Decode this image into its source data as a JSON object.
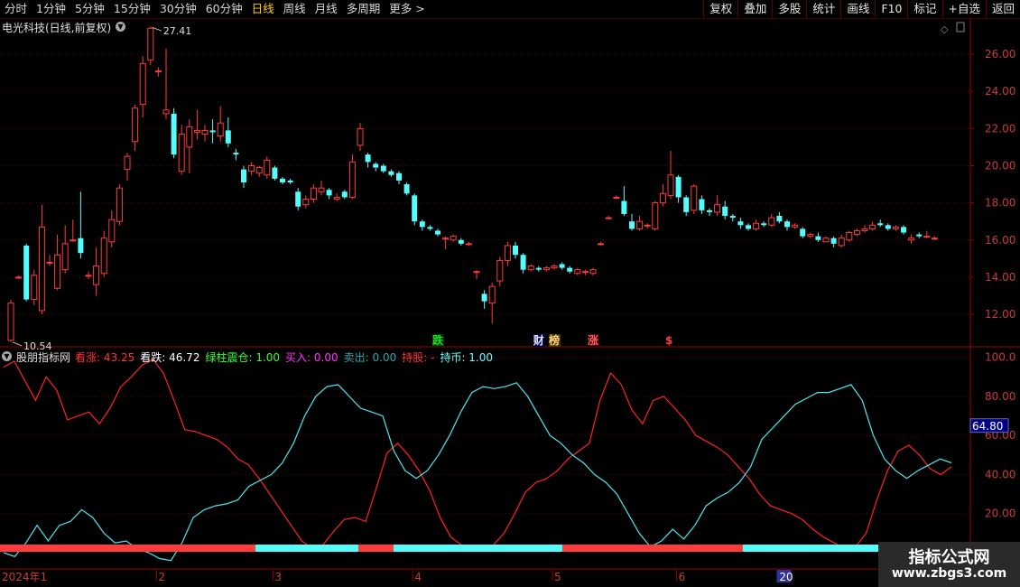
{
  "toolbar": {
    "periods": [
      {
        "label": "分时",
        "active": false
      },
      {
        "label": "1分钟",
        "active": false
      },
      {
        "label": "5分钟",
        "active": false
      },
      {
        "label": "15分钟",
        "active": false
      },
      {
        "label": "30分钟",
        "active": false
      },
      {
        "label": "60分钟",
        "active": false
      },
      {
        "label": "日线",
        "active": true
      },
      {
        "label": "周线",
        "active": false
      },
      {
        "label": "月线",
        "active": false
      },
      {
        "label": "多周期",
        "active": false
      },
      {
        "label": "更多",
        "active": false
      }
    ],
    "more_arrow": ">",
    "tools": [
      "复权",
      "叠加",
      "多股",
      "统计",
      "画线",
      "F10",
      "标记",
      "+自选",
      "返回"
    ]
  },
  "stock": {
    "title": "电光科技(日线,前复权)",
    "high_label": "27.41",
    "low_label": "10.54"
  },
  "price_axis": [
    "26.00",
    "24.00",
    "22.00",
    "20.00",
    "18.00",
    "16.00",
    "14.00",
    "12.00"
  ],
  "events": [
    {
      "label": "跌",
      "day": 55,
      "color": "#22dd22",
      "bg": "#003300"
    },
    {
      "label": "财",
      "day": 68,
      "color": "#e0e0ff",
      "bg": "#000044"
    },
    {
      "label": "榜",
      "day": 70,
      "color": "#ffd080",
      "bg": "#443300"
    },
    {
      "label": "涨",
      "day": 75,
      "color": "#ff6060",
      "bg": "#330000"
    },
    {
      "label": "$",
      "day": 85,
      "color": "#ff4040",
      "bg": ""
    }
  ],
  "indicator": {
    "name": "股朋指标网",
    "fields": [
      {
        "label": "看涨:",
        "value": "43.25",
        "color": "#ff3333"
      },
      {
        "label": "看跌:",
        "value": "46.72",
        "color": "#ffffff"
      },
      {
        "label": "绿柱震仓:",
        "value": "1.00",
        "color": "#33ff33"
      },
      {
        "label": "买入:",
        "value": "0.00",
        "color": "#ff33ff"
      },
      {
        "label": "卖出:",
        "value": "0.00",
        "color": "#22aaaa"
      },
      {
        "label": "持股:",
        "value": "-",
        "color": "#ff3333"
      },
      {
        "label": "持币:",
        "value": "1.00",
        "color": "#66ffff"
      }
    ],
    "axis": [
      "100.0",
      "80.00",
      "60.00",
      "40.00",
      "20.00"
    ],
    "current_label": "64.80"
  },
  "time_axis": [
    {
      "label": "2024年1",
      "day": 0
    },
    {
      "label": "2",
      "day": 19
    },
    {
      "label": "3",
      "day": 34
    },
    {
      "label": "4",
      "day": 52
    },
    {
      "label": "5",
      "day": 70
    },
    {
      "label": "6",
      "day": 86
    },
    {
      "label": "20",
      "day": 99
    }
  ],
  "watermark": {
    "title": "指标公式网",
    "url": "www.zbgs3.com"
  },
  "colors": {
    "up": "#ff3c3c",
    "down": "#54fcfc",
    "grid": "#7a0000",
    "axis_text": "#c83c3c",
    "kanzhang": "#ff2222",
    "kandie": "#4fe6f0"
  },
  "chart_data": [
    {
      "type": "candlestick",
      "x": "trading day index",
      "ylim": [
        10.3,
        27.9
      ],
      "candles": [
        {
          "o": 10.6,
          "c": 12.6,
          "h": 12.8,
          "l": 10.5
        },
        {
          "o": 14.0,
          "c": 14.0,
          "h": 14.1,
          "l": 13.9
        },
        {
          "o": 15.7,
          "c": 12.8,
          "h": 15.8,
          "l": 12.7
        },
        {
          "o": 12.8,
          "c": 14.1,
          "h": 14.4,
          "l": 12.5
        },
        {
          "o": 12.2,
          "c": 16.7,
          "h": 17.9,
          "l": 12.0
        },
        {
          "o": 14.8,
          "c": 14.8,
          "h": 15.2,
          "l": 14.6
        },
        {
          "o": 13.4,
          "c": 15.2,
          "h": 16.3,
          "l": 13.3
        },
        {
          "o": 14.4,
          "c": 15.8,
          "h": 16.8,
          "l": 14.2
        },
        {
          "o": 16.0,
          "c": 16.0,
          "h": 17.1,
          "l": 15.9
        },
        {
          "o": 16.1,
          "c": 15.3,
          "h": 18.6,
          "l": 15.0
        },
        {
          "o": 14.1,
          "c": 14.1,
          "h": 14.3,
          "l": 13.9
        },
        {
          "o": 13.6,
          "c": 14.6,
          "h": 15.6,
          "l": 13.0
        },
        {
          "o": 14.2,
          "c": 16.1,
          "h": 16.5,
          "l": 14.0
        },
        {
          "o": 15.9,
          "c": 17.1,
          "h": 17.6,
          "l": 15.6
        },
        {
          "o": 17.0,
          "c": 18.8,
          "h": 19.0,
          "l": 16.8
        },
        {
          "o": 19.8,
          "c": 20.5,
          "h": 20.7,
          "l": 19.2
        },
        {
          "o": 21.3,
          "c": 23.1,
          "h": 23.3,
          "l": 20.8
        },
        {
          "o": 23.3,
          "c": 25.5,
          "h": 25.9,
          "l": 22.6
        },
        {
          "o": 25.7,
          "c": 27.4,
          "h": 27.5,
          "l": 25.4
        },
        {
          "o": 25.1,
          "c": 25.1,
          "h": 25.3,
          "l": 24.8
        },
        {
          "o": 22.8,
          "c": 23.0,
          "h": 26.3,
          "l": 22.5
        },
        {
          "o": 22.8,
          "c": 20.6,
          "h": 23.1,
          "l": 20.4
        },
        {
          "o": 19.7,
          "c": 21.7,
          "h": 22.2,
          "l": 19.5
        },
        {
          "o": 21.0,
          "c": 22.1,
          "h": 22.5,
          "l": 19.6
        },
        {
          "o": 21.8,
          "c": 21.9,
          "h": 23.0,
          "l": 21.4
        },
        {
          "o": 21.7,
          "c": 21.9,
          "h": 22.2,
          "l": 21.3
        },
        {
          "o": 21.9,
          "c": 21.8,
          "h": 22.5,
          "l": 21.2
        },
        {
          "o": 21.6,
          "c": 22.3,
          "h": 23.2,
          "l": 21.3
        },
        {
          "o": 21.9,
          "c": 21.2,
          "h": 22.6,
          "l": 21.0
        },
        {
          "o": 20.7,
          "c": 20.6,
          "h": 20.9,
          "l": 20.3
        },
        {
          "o": 19.8,
          "c": 19.1,
          "h": 20.0,
          "l": 18.8
        },
        {
          "o": 19.7,
          "c": 20.0,
          "h": 20.2,
          "l": 19.5
        },
        {
          "o": 19.6,
          "c": 19.9,
          "h": 20.0,
          "l": 19.4
        },
        {
          "o": 19.5,
          "c": 20.3,
          "h": 20.5,
          "l": 19.3
        },
        {
          "o": 19.9,
          "c": 19.3,
          "h": 20.0,
          "l": 19.2
        },
        {
          "o": 19.3,
          "c": 19.1,
          "h": 19.4,
          "l": 19.0
        },
        {
          "o": 19.2,
          "c": 19.1,
          "h": 19.3,
          "l": 19.0
        },
        {
          "o": 18.6,
          "c": 17.8,
          "h": 18.8,
          "l": 17.6
        },
        {
          "o": 17.9,
          "c": 18.2,
          "h": 18.4,
          "l": 17.7
        },
        {
          "o": 18.2,
          "c": 18.8,
          "h": 19.0,
          "l": 18.0
        },
        {
          "o": 18.6,
          "c": 18.8,
          "h": 19.2,
          "l": 18.4
        },
        {
          "o": 18.7,
          "c": 18.4,
          "h": 18.8,
          "l": 18.2
        },
        {
          "o": 18.2,
          "c": 18.3,
          "h": 18.5,
          "l": 18.1
        },
        {
          "o": 18.6,
          "c": 18.3,
          "h": 18.7,
          "l": 18.2
        },
        {
          "o": 18.3,
          "c": 20.2,
          "h": 20.6,
          "l": 18.2
        },
        {
          "o": 21.1,
          "c": 22.0,
          "h": 22.3,
          "l": 20.8
        },
        {
          "o": 20.6,
          "c": 20.2,
          "h": 20.7,
          "l": 19.9
        },
        {
          "o": 20.1,
          "c": 19.9,
          "h": 20.2,
          "l": 19.7
        },
        {
          "o": 20.0,
          "c": 19.7,
          "h": 20.1,
          "l": 19.6
        },
        {
          "o": 19.7,
          "c": 19.5,
          "h": 19.8,
          "l": 19.4
        },
        {
          "o": 19.6,
          "c": 19.2,
          "h": 19.7,
          "l": 19.0
        },
        {
          "o": 19.0,
          "c": 18.5,
          "h": 19.1,
          "l": 18.4
        },
        {
          "o": 18.4,
          "c": 17.0,
          "h": 18.5,
          "l": 16.8
        },
        {
          "o": 17.0,
          "c": 16.7,
          "h": 17.1,
          "l": 16.5
        },
        {
          "o": 16.7,
          "c": 16.6,
          "h": 16.8,
          "l": 16.5
        },
        {
          "o": 16.5,
          "c": 16.3,
          "h": 16.6,
          "l": 16.2
        },
        {
          "o": 16.1,
          "c": 16.1,
          "h": 16.2,
          "l": 15.5
        },
        {
          "o": 16.0,
          "c": 16.2,
          "h": 16.3,
          "l": 15.9
        },
        {
          "o": 16.0,
          "c": 15.8,
          "h": 16.1,
          "l": 15.7
        },
        {
          "o": 15.8,
          "c": 15.8,
          "h": 15.9,
          "l": 15.7
        },
        {
          "o": 14.3,
          "c": 14.3,
          "h": 14.4,
          "l": 13.9
        },
        {
          "o": 13.1,
          "c": 12.7,
          "h": 13.3,
          "l": 12.3
        },
        {
          "o": 12.6,
          "c": 13.5,
          "h": 13.7,
          "l": 11.5
        },
        {
          "o": 13.8,
          "c": 14.9,
          "h": 15.1,
          "l": 13.5
        },
        {
          "o": 14.9,
          "c": 15.7,
          "h": 15.9,
          "l": 14.6
        },
        {
          "o": 15.7,
          "c": 15.2,
          "h": 15.9,
          "l": 15.0
        },
        {
          "o": 15.2,
          "c": 14.4,
          "h": 15.3,
          "l": 14.2
        },
        {
          "o": 14.4,
          "c": 14.6,
          "h": 14.7,
          "l": 14.3
        },
        {
          "o": 14.5,
          "c": 14.4,
          "h": 14.6,
          "l": 14.3
        },
        {
          "o": 14.4,
          "c": 14.5,
          "h": 14.6,
          "l": 14.3
        },
        {
          "o": 14.5,
          "c": 14.6,
          "h": 14.7,
          "l": 14.4
        },
        {
          "o": 14.7,
          "c": 14.5,
          "h": 14.8,
          "l": 14.4
        },
        {
          "o": 14.5,
          "c": 14.3,
          "h": 14.6,
          "l": 14.2
        },
        {
          "o": 14.2,
          "c": 14.4,
          "h": 14.5,
          "l": 14.1
        },
        {
          "o": 14.3,
          "c": 14.3,
          "h": 14.4,
          "l": 14.1
        },
        {
          "o": 14.2,
          "c": 14.4,
          "h": 14.5,
          "l": 14.1
        },
        {
          "o": 15.8,
          "c": 15.8,
          "h": 15.9,
          "l": 15.7
        },
        {
          "o": 17.2,
          "c": 17.2,
          "h": 17.3,
          "l": 17.1
        },
        {
          "o": 18.3,
          "c": 18.3,
          "h": 18.4,
          "l": 18.2
        },
        {
          "o": 18.1,
          "c": 17.4,
          "h": 18.9,
          "l": 17.3
        },
        {
          "o": 17.0,
          "c": 16.6,
          "h": 17.4,
          "l": 16.5
        },
        {
          "o": 16.6,
          "c": 17.0,
          "h": 17.3,
          "l": 16.5
        },
        {
          "o": 16.8,
          "c": 16.8,
          "h": 16.9,
          "l": 16.6
        },
        {
          "o": 16.6,
          "c": 18.0,
          "h": 18.1,
          "l": 16.5
        },
        {
          "o": 18.0,
          "c": 18.5,
          "h": 19.0,
          "l": 17.8
        },
        {
          "o": 18.4,
          "c": 19.5,
          "h": 20.8,
          "l": 18.2
        },
        {
          "o": 19.4,
          "c": 18.3,
          "h": 19.5,
          "l": 18.0
        },
        {
          "o": 18.3,
          "c": 17.5,
          "h": 18.4,
          "l": 17.3
        },
        {
          "o": 17.6,
          "c": 18.9,
          "h": 19.0,
          "l": 17.4
        },
        {
          "o": 18.2,
          "c": 17.6,
          "h": 18.4,
          "l": 17.4
        },
        {
          "o": 17.6,
          "c": 17.5,
          "h": 17.7,
          "l": 17.3
        },
        {
          "o": 17.5,
          "c": 17.9,
          "h": 18.4,
          "l": 17.3
        },
        {
          "o": 17.8,
          "c": 17.3,
          "h": 18.1,
          "l": 17.1
        },
        {
          "o": 17.3,
          "c": 17.2,
          "h": 17.4,
          "l": 17.0
        },
        {
          "o": 17.0,
          "c": 16.8,
          "h": 17.2,
          "l": 16.6
        },
        {
          "o": 16.8,
          "c": 16.6,
          "h": 16.9,
          "l": 16.5
        },
        {
          "o": 16.6,
          "c": 16.9,
          "h": 17.1,
          "l": 16.5
        },
        {
          "o": 16.9,
          "c": 16.8,
          "h": 17.0,
          "l": 16.7
        },
        {
          "o": 16.8,
          "c": 17.2,
          "h": 17.4,
          "l": 16.7
        },
        {
          "o": 17.3,
          "c": 17.0,
          "h": 17.5,
          "l": 16.9
        },
        {
          "o": 17.0,
          "c": 16.7,
          "h": 17.1,
          "l": 16.5
        },
        {
          "o": 16.7,
          "c": 16.8,
          "h": 16.9,
          "l": 16.6
        },
        {
          "o": 16.6,
          "c": 16.2,
          "h": 16.7,
          "l": 16.1
        },
        {
          "o": 16.2,
          "c": 16.3,
          "h": 16.4,
          "l": 16.1
        },
        {
          "o": 16.2,
          "c": 16.0,
          "h": 16.4,
          "l": 15.9
        },
        {
          "o": 15.9,
          "c": 16.1,
          "h": 16.2,
          "l": 15.9
        },
        {
          "o": 16.1,
          "c": 15.8,
          "h": 16.2,
          "l": 15.6
        },
        {
          "o": 15.7,
          "c": 16.1,
          "h": 16.3,
          "l": 15.6
        },
        {
          "o": 16.0,
          "c": 16.4,
          "h": 16.5,
          "l": 15.9
        },
        {
          "o": 16.3,
          "c": 16.5,
          "h": 16.6,
          "l": 16.2
        },
        {
          "o": 16.5,
          "c": 16.6,
          "h": 16.8,
          "l": 16.4
        },
        {
          "o": 16.6,
          "c": 16.8,
          "h": 17.0,
          "l": 16.5
        },
        {
          "o": 16.9,
          "c": 16.8,
          "h": 17.1,
          "l": 16.7
        },
        {
          "o": 16.8,
          "c": 16.6,
          "h": 16.9,
          "l": 16.5
        },
        {
          "o": 16.6,
          "c": 16.7,
          "h": 16.8,
          "l": 16.5
        },
        {
          "o": 16.7,
          "c": 16.4,
          "h": 16.8,
          "l": 16.3
        },
        {
          "o": 16.0,
          "c": 16.1,
          "h": 16.3,
          "l": 15.8
        },
        {
          "o": 16.3,
          "c": 16.2,
          "h": 16.4,
          "l": 16.1
        },
        {
          "o": 16.2,
          "c": 16.2,
          "h": 16.5,
          "l": 16.1
        },
        {
          "o": 16.1,
          "c": 16.1,
          "h": 16.2,
          "l": 16.0
        }
      ]
    },
    {
      "type": "line",
      "x": "trading day index",
      "ylim": [
        -6,
        104
      ],
      "series": [
        {
          "name": "看涨",
          "color": "#ff2222",
          "values": [
            95,
            98,
            88,
            78,
            90,
            83,
            68,
            70,
            72,
            66,
            74,
            85,
            90,
            96,
            99,
            92,
            78,
            63,
            62,
            60,
            58,
            54,
            48,
            45,
            38,
            30,
            22,
            14,
            6,
            2,
            4,
            11,
            17,
            18,
            16,
            33,
            51,
            56,
            50,
            42,
            32,
            18,
            8,
            4,
            2,
            2,
            4,
            10,
            20,
            31,
            36,
            38,
            42,
            48,
            52,
            56,
            78,
            92,
            86,
            73,
            66,
            78,
            80,
            74,
            68,
            60,
            57,
            54,
            50,
            44,
            38,
            30,
            24,
            22,
            20,
            17,
            12,
            8,
            5,
            2,
            3,
            10,
            27,
            42,
            52,
            55,
            50,
            43,
            40,
            44
          ]
        },
        {
          "name": "看跌",
          "color": "#4fe6f0",
          "values": [
            0,
            -2,
            5,
            14,
            6,
            14,
            16,
            22,
            18,
            10,
            5,
            6,
            2,
            0,
            -3,
            -4,
            5,
            18,
            22,
            24,
            25,
            27,
            34,
            37,
            40,
            46,
            56,
            70,
            80,
            85,
            86,
            80,
            74,
            72,
            70,
            52,
            42,
            38,
            42,
            50,
            60,
            72,
            82,
            85,
            84,
            85,
            87,
            80,
            70,
            60,
            56,
            50,
            46,
            40,
            36,
            30,
            20,
            10,
            3,
            6,
            12,
            7,
            14,
            24,
            28,
            31,
            36,
            44,
            58,
            64,
            70,
            76,
            79,
            82,
            82,
            84,
            86,
            78,
            60,
            48,
            42,
            38,
            42,
            45,
            48,
            46
          ]
        }
      ]
    }
  ]
}
